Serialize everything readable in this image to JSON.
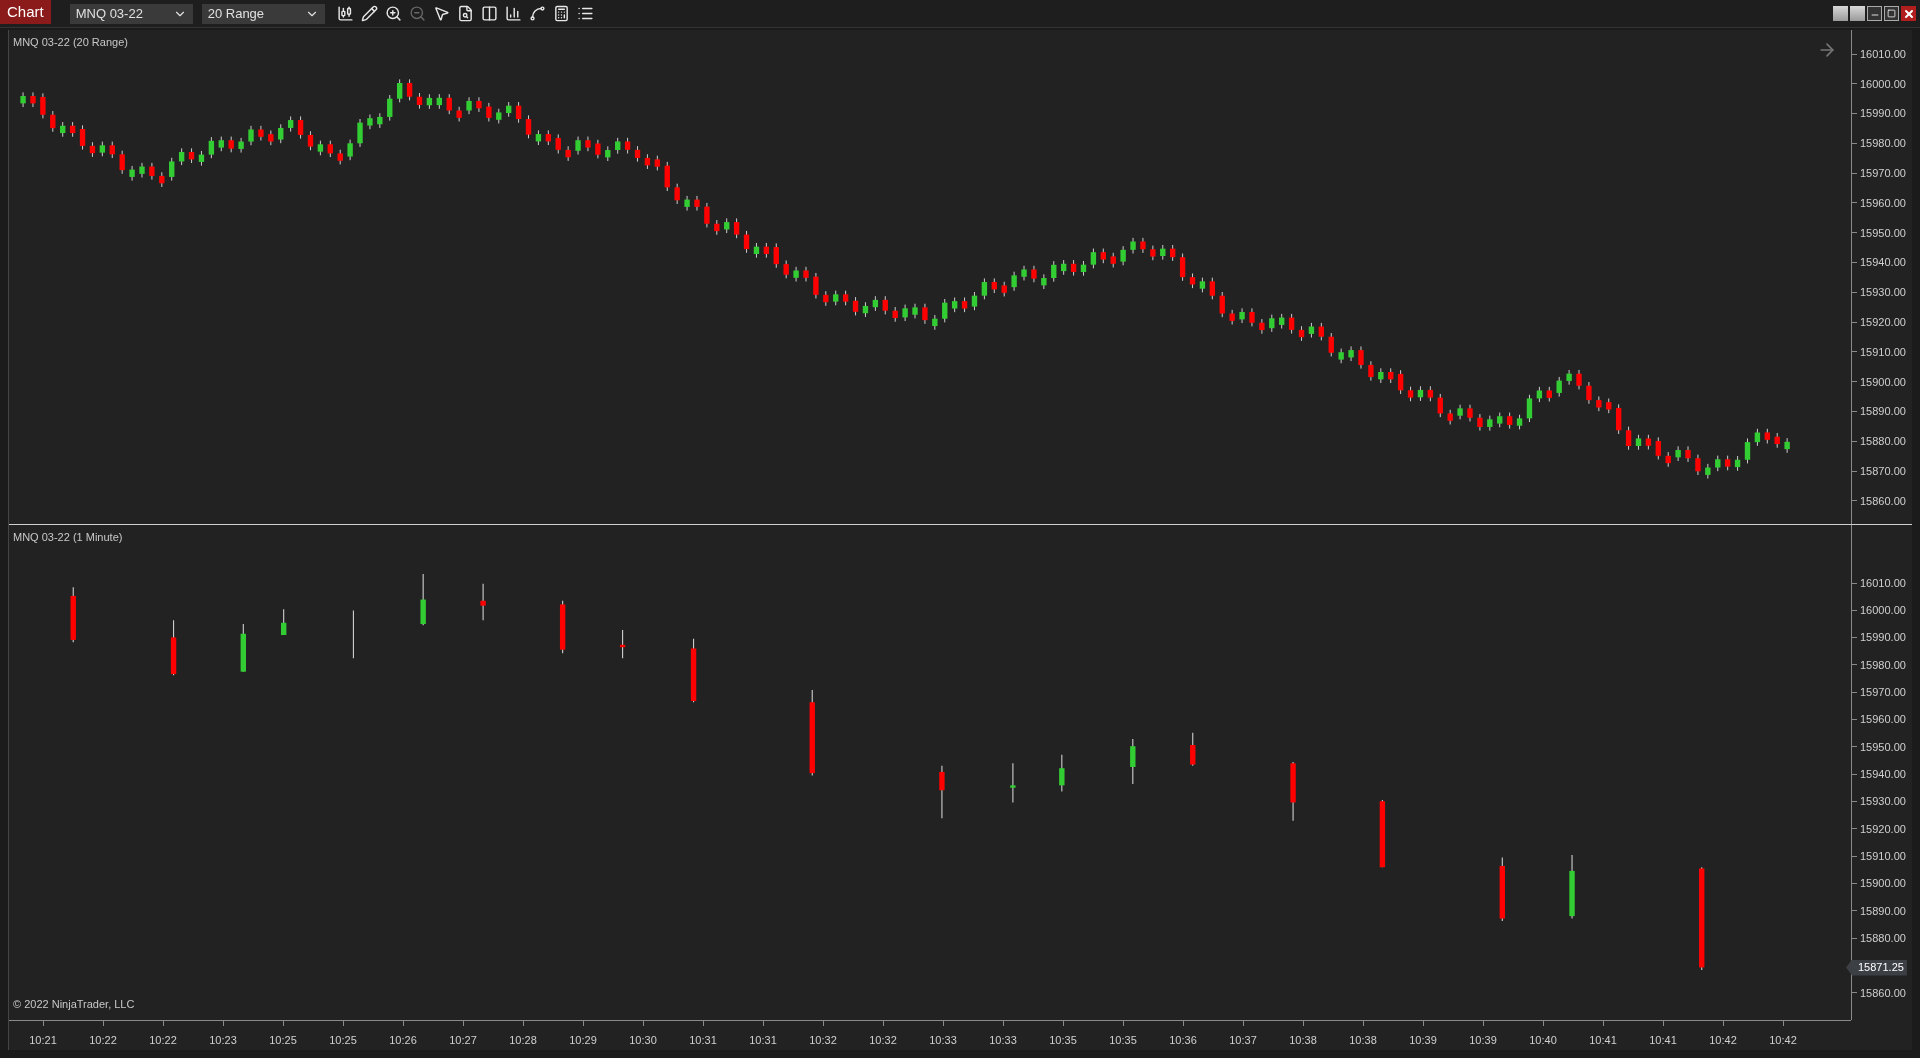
{
  "toolbar": {
    "title": "Chart",
    "instrument": "MNQ 03-22",
    "period": "20 Range",
    "tools": [
      {
        "kind": "candles",
        "disabled": false
      },
      {
        "kind": "pencil",
        "disabled": false
      },
      {
        "kind": "zoom_in",
        "disabled": false
      },
      {
        "kind": "zoom_out",
        "disabled": true
      },
      {
        "kind": "pointer",
        "disabled": false
      },
      {
        "kind": "properties",
        "disabled": false
      },
      {
        "kind": "panels",
        "disabled": false
      },
      {
        "kind": "bars",
        "disabled": false
      },
      {
        "kind": "strategy",
        "disabled": false
      },
      {
        "kind": "calculator",
        "disabled": false
      },
      {
        "kind": "list",
        "disabled": false
      }
    ]
  },
  "panels": [
    {
      "kind": "range",
      "title": "MNQ 03-22 (20 Range)",
      "price_labels": [
        "16010.00",
        "16000.00",
        "15990.00",
        "15980.00",
        "15970.00",
        "15960.00",
        "15950.00",
        "15940.00",
        "15930.00",
        "15920.00",
        "15910.00",
        "15900.00",
        "15890.00",
        "15880.00",
        "15870.00",
        "15860.00"
      ]
    },
    {
      "kind": "minute",
      "title": "MNQ 03-22 (1 Minute)",
      "price_labels": [
        "16010.00",
        "16000.00",
        "15990.00",
        "15980.00",
        "15970.00",
        "15960.00",
        "15950.00",
        "15940.00",
        "15930.00",
        "15920.00",
        "15910.00",
        "15900.00",
        "15890.00",
        "15880.00",
        {
          "kind": "last",
          "text": "15871.25"
        },
        "15860.00"
      ],
      "copyright": "© 2022 NinjaTrader, LLC"
    }
  ],
  "time_labels": [
    "10:21",
    "10:22",
    "10:22",
    "10:23",
    "10:25",
    "10:25",
    "10:26",
    "10:27",
    "10:28",
    "10:29",
    "10:30",
    "10:31",
    "10:31",
    "10:32",
    "10:32",
    "10:33",
    "10:33",
    "10:35",
    "10:35",
    "10:36",
    "10:37",
    "10:38",
    "10:38",
    "10:39",
    "10:39",
    "10:40",
    "10:41",
    "10:41",
    "10:42",
    "10:42"
  ]
}
